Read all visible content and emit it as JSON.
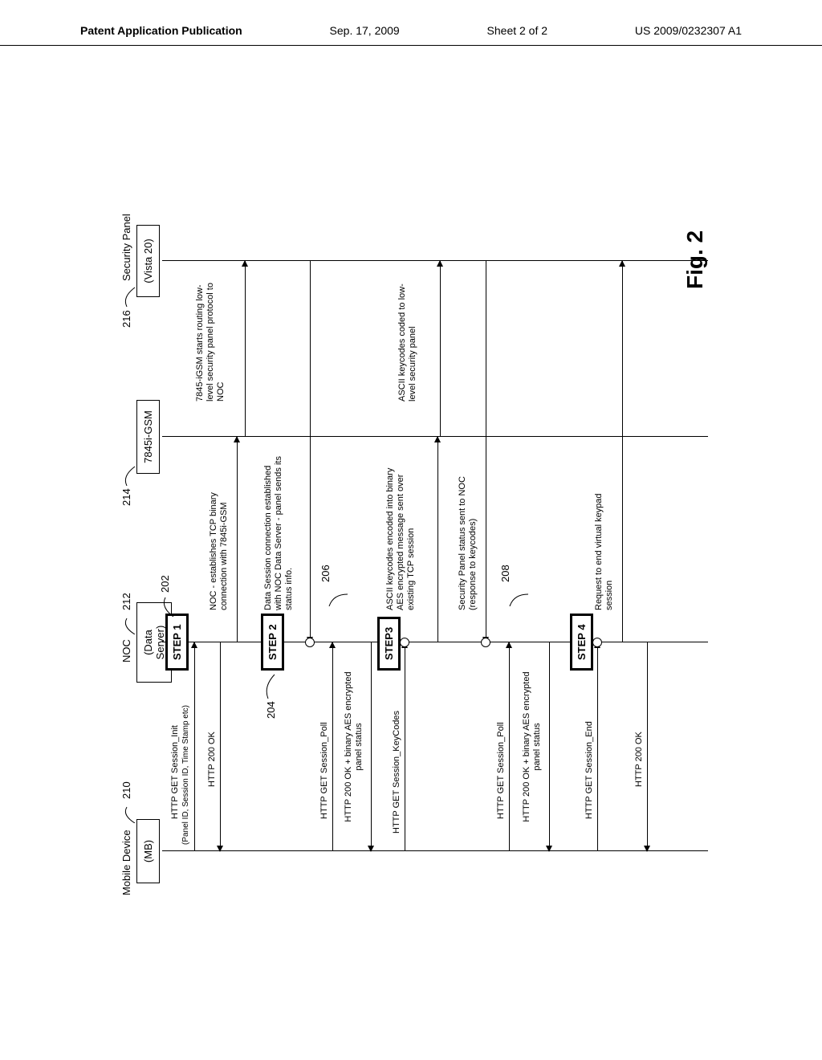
{
  "header": {
    "publication": "Patent Application Publication",
    "date": "Sep. 17, 2009",
    "sheet": "Sheet 2 of 2",
    "docnum": "US 2009/0232307 A1"
  },
  "figure_label": "Fig. 2",
  "participants": {
    "mobile": {
      "title": "Mobile Device",
      "sub": "(MB)",
      "ref": "210"
    },
    "noc": {
      "title": "NOC",
      "sub": "(Data Server)",
      "ref": "212"
    },
    "igsm": {
      "title": "7845i-GSM",
      "sub": "",
      "ref": "214"
    },
    "panel": {
      "title": "Security Panel",
      "sub": "(Vista 20)",
      "ref": "216"
    }
  },
  "steps": {
    "s1": {
      "label": "STEP 1",
      "ref": "202"
    },
    "s2": {
      "label": "STEP 2",
      "ref": "204"
    },
    "s3": {
      "label": "STEP3",
      "ref": "206"
    },
    "s4": {
      "label": "STEP 4",
      "ref": "208"
    }
  },
  "messages": {
    "m1": "HTTP GET  Session_Init",
    "m1b": "(Panel ID, Session ID, Time Stamp etc)",
    "m2": "HTTP 200 OK",
    "m3": "NOC - establishes TCP binary connection with 7845i-GSM",
    "m4": "Data Session connection established with NOC Data Server - panel sends its  status info.",
    "m5": "7845-iGSM starts routing low-level security panel protocol to NOC",
    "m6": "HTTP GET Session_Poll",
    "m7": "HTTP 200 OK + binary AES encrypted panel status",
    "m8": "HTTP GET Session_KeyCodes",
    "m9": "ASCII keycodes encoded into binary AES encrypted message sent over existing TCP session",
    "m10": "ASCII keycodes coded to low-level security panel",
    "m11": "HTTP GET Session_Poll",
    "m12": "HTTP 200 OK + binary AES encrypted panel status",
    "m13": "Security Panel status sent to NOC (response to keycodes)",
    "m14": "HTTP GET Session_End",
    "m15": "HTTP 200 OK",
    "m16": "Request to end virtual keypad session"
  }
}
